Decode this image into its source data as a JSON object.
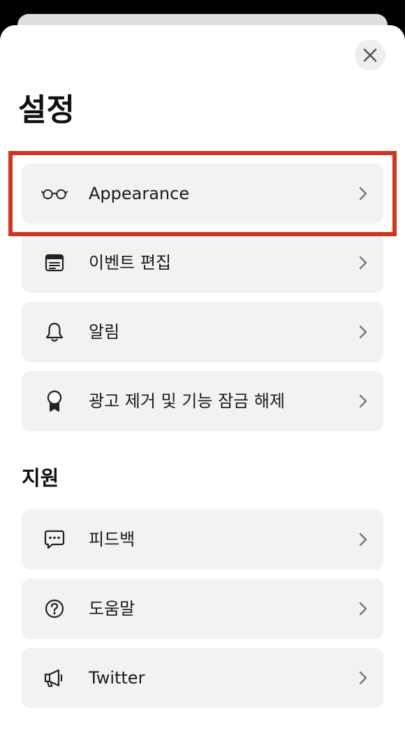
{
  "header": {
    "title": "설정"
  },
  "sections": {
    "support_title": "지원"
  },
  "menu": {
    "appearance": {
      "label": "Appearance",
      "icon": "glasses-icon"
    },
    "edit_events": {
      "label": "이벤트 편집",
      "icon": "calendar-list-icon"
    },
    "notifications": {
      "label": "알림",
      "icon": "bell-icon"
    },
    "remove_ads": {
      "label": "광고 제거 및 기능 잠금 해제",
      "icon": "award-ribbon-icon"
    },
    "feedback": {
      "label": "피드백",
      "icon": "chat-bubble-icon"
    },
    "help": {
      "label": "도움말",
      "icon": "question-circle-icon"
    },
    "twitter": {
      "label": "Twitter",
      "icon": "megaphone-icon"
    }
  },
  "colors": {
    "highlight": "#d0361f",
    "row_background": "#f2f2f2",
    "sheet_background": "#ffffff"
  }
}
